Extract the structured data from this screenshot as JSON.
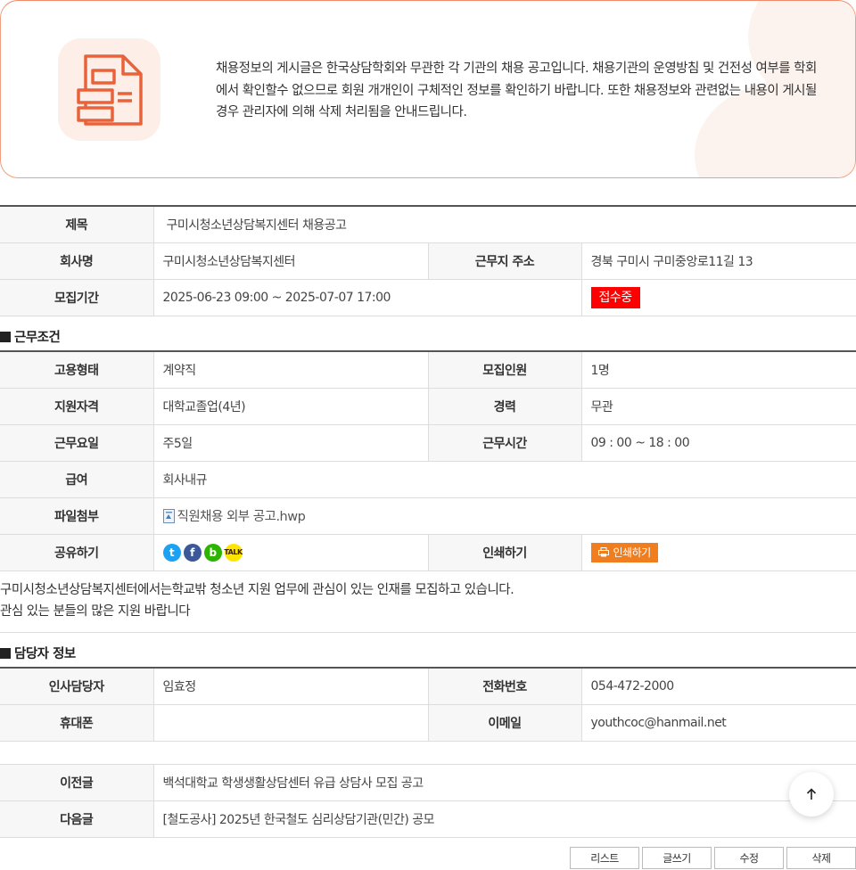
{
  "notice": {
    "text": "채용정보의 게시글은 한국상담학회와 무관한 각 기관의 채용 공고입니다. 채용기관의 운영방침 및 건전성 여부를 학회에서 확인할수 없으므로 회원 개개인이 구체적인 정보를 확인하기 바랍니다. 또한 채용정보와 관련없는 내용이 게시될 경우 관리자에 의해 삭제 처리됨을 안내드립니다.",
    "icon": "document-icon",
    "accent": "#e8623a"
  },
  "post": {
    "title_label": "제목",
    "title": "구미시청소년상담복지센터 채용공고",
    "company_label": "회사명",
    "company": "구미시청소년상담복지센터",
    "address_label": "근무지 주소",
    "address": "경북 구미시 구미중앙로11길 13",
    "period_label": "모집기간",
    "period": "2025-06-23 09:00 ~ 2025-07-07 17:00",
    "status": "접수중",
    "status_color": "#ff0000"
  },
  "conditions": {
    "section_title": "근무조건",
    "employment_label": "고용형태",
    "employment": "계약직",
    "headcount_label": "모집인원",
    "headcount": "1명",
    "qualification_label": "지원자격",
    "qualification": "대학교졸업(4년)",
    "career_label": "경력",
    "career": "무관",
    "workdays_label": "근무요일",
    "workdays": "주5일",
    "hours_label": "근무시간",
    "hours": "09 : 00 ~ 18 : 00",
    "salary_label": "급여",
    "salary": "회사내규",
    "file_label": "파일첨부",
    "file": "직원채용 외부 공고.hwp",
    "share_label": "공유하기",
    "print_label": "인쇄하기",
    "print_button": "인쇄하기"
  },
  "body": {
    "line1": "구미시청소년상담복지센터에서는학교밖 청소년 지원 업무에 관심이 있는 인재를 모집하고 있습니다.",
    "line2": "관심 있는 분들의 많은 지원 바랍니다"
  },
  "contact": {
    "section_title": "담당자 정보",
    "manager_label": "인사담당자",
    "manager": "임효정",
    "phone_label": "전화번호",
    "phone": "054-472-2000",
    "mobile_label": "휴대폰",
    "mobile": "",
    "email_label": "이메일",
    "email": "youthcoc@hanmail.net"
  },
  "nav": {
    "prev_label": "이전글",
    "prev": "백석대학교 학생생활상담센터 유급 상담사 모집 공고",
    "next_label": "다음글",
    "next": "[철도공사] 2025년 한국철도 심리상담기관(민간) 공모"
  },
  "buttons": {
    "list": "리스트",
    "write": "글쓰기",
    "edit": "수정",
    "delete": "삭제"
  }
}
